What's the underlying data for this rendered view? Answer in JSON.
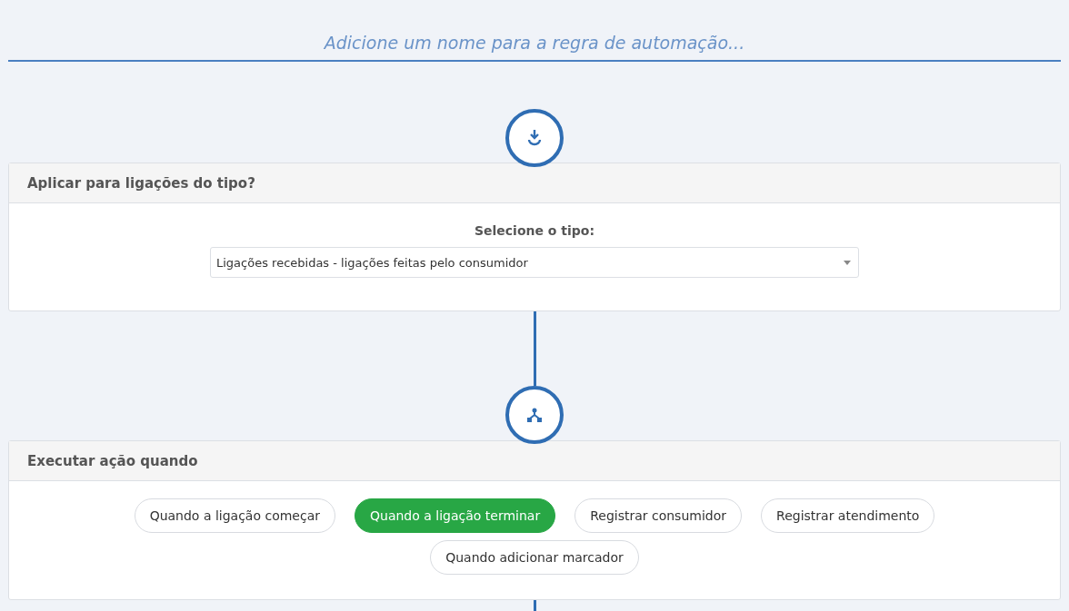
{
  "rule_name": {
    "placeholder": "Adicione um nome para a regra de automação..."
  },
  "type_card": {
    "title": "Aplicar para ligações do tipo?",
    "label": "Selecione o tipo:",
    "select_value": "Ligações recebidas - ligações feitas pelo consumidor"
  },
  "trigger_card": {
    "title": "Executar ação quando",
    "options": [
      {
        "label": "Quando a ligação começar",
        "selected": false
      },
      {
        "label": "Quando a ligação terminar",
        "selected": true
      },
      {
        "label": "Registrar consumidor",
        "selected": false
      },
      {
        "label": "Registrar atendimento",
        "selected": false
      },
      {
        "label": "Quando adicionar marcador",
        "selected": false
      }
    ]
  }
}
